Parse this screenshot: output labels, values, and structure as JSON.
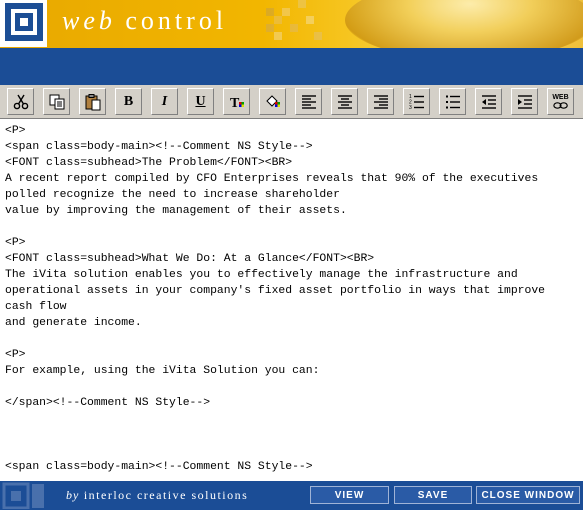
{
  "header": {
    "brand_web": "web",
    "brand_control": "control"
  },
  "toolbar": {
    "buttons": [
      {
        "name": "cut-button",
        "icon": "scissors-icon"
      },
      {
        "name": "copy-button",
        "icon": "copy-icon"
      },
      {
        "name": "paste-button",
        "icon": "paste-icon"
      },
      {
        "name": "bold-button",
        "icon": "bold-icon",
        "glyph": "B"
      },
      {
        "name": "italic-button",
        "icon": "italic-icon",
        "glyph": "I"
      },
      {
        "name": "underline-button",
        "icon": "underline-icon",
        "glyph": "U"
      },
      {
        "name": "text-color-button",
        "icon": "text-color-icon",
        "glyph": "T"
      },
      {
        "name": "highlight-button",
        "icon": "paint-bucket-icon"
      },
      {
        "name": "align-left-button",
        "icon": "align-left-icon"
      },
      {
        "name": "align-center-button",
        "icon": "align-center-icon"
      },
      {
        "name": "align-right-button",
        "icon": "align-right-icon"
      },
      {
        "name": "numbered-list-button",
        "icon": "numbered-list-icon"
      },
      {
        "name": "bullet-list-button",
        "icon": "bullet-list-icon"
      },
      {
        "name": "outdent-button",
        "icon": "outdent-icon"
      },
      {
        "name": "indent-button",
        "icon": "indent-icon"
      },
      {
        "name": "web-link-button",
        "icon": "web-link-icon",
        "glyph": "WEB"
      }
    ]
  },
  "editor": {
    "content": "<P>\n<span class=body-main><!--Comment NS Style-->\n<FONT class=subhead>The Problem</FONT><BR>\nA recent report compiled by CFO Enterprises reveals that 90% of the executives\npolled recognize the need to increase shareholder\nvalue by improving the management of their assets.\n\n<P>\n<FONT class=subhead>What We Do: At a Glance</FONT><BR>\nThe iVita solution enables you to effectively manage the infrastructure and\noperational assets in your company's fixed asset portfolio in ways that improve\ncash flow\nand generate income.\n\n<P>\nFor example, using the iVita Solution you can:\n\n</span><!--Comment NS Style-->\n\n\n\n<span class=body-main><!--Comment NS Style-->"
  },
  "footer": {
    "by": "by",
    "company": "interloc creative solutions",
    "view_label": "VIEW",
    "save_label": "SAVE",
    "close_label": "CLOSE WINDOW"
  },
  "colors": {
    "brand_blue": "#1b4d96",
    "brand_gold": "#f2b600",
    "toolbar_gray": "#d4d0c8"
  }
}
